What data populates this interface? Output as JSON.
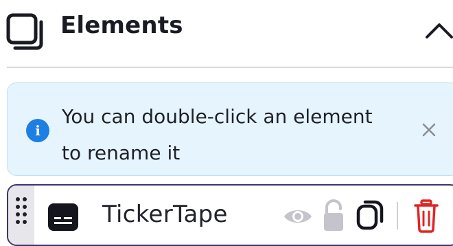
{
  "panel": {
    "title": "Elements"
  },
  "info_banner": {
    "line1": "You can double-click an element",
    "line2": "to rename it"
  },
  "elements": [
    {
      "name": "TickerTape"
    }
  ],
  "icons": {
    "panel": "layers-icon",
    "collapse": "chevron-up-icon",
    "info": "info-icon",
    "close": "close-icon",
    "drag": "drag-handle-icon",
    "element_type": "ticker-widget-icon",
    "visibility": "eye-icon",
    "lock": "unlock-icon",
    "duplicate": "duplicate-icon",
    "delete": "trash-icon"
  },
  "colors": {
    "info_accent": "#1d7fe3",
    "banner_bg": "#e6f4fd",
    "row_border": "#3a3470",
    "delete": "#e02424",
    "disabled_icon": "#b9b9bf"
  }
}
